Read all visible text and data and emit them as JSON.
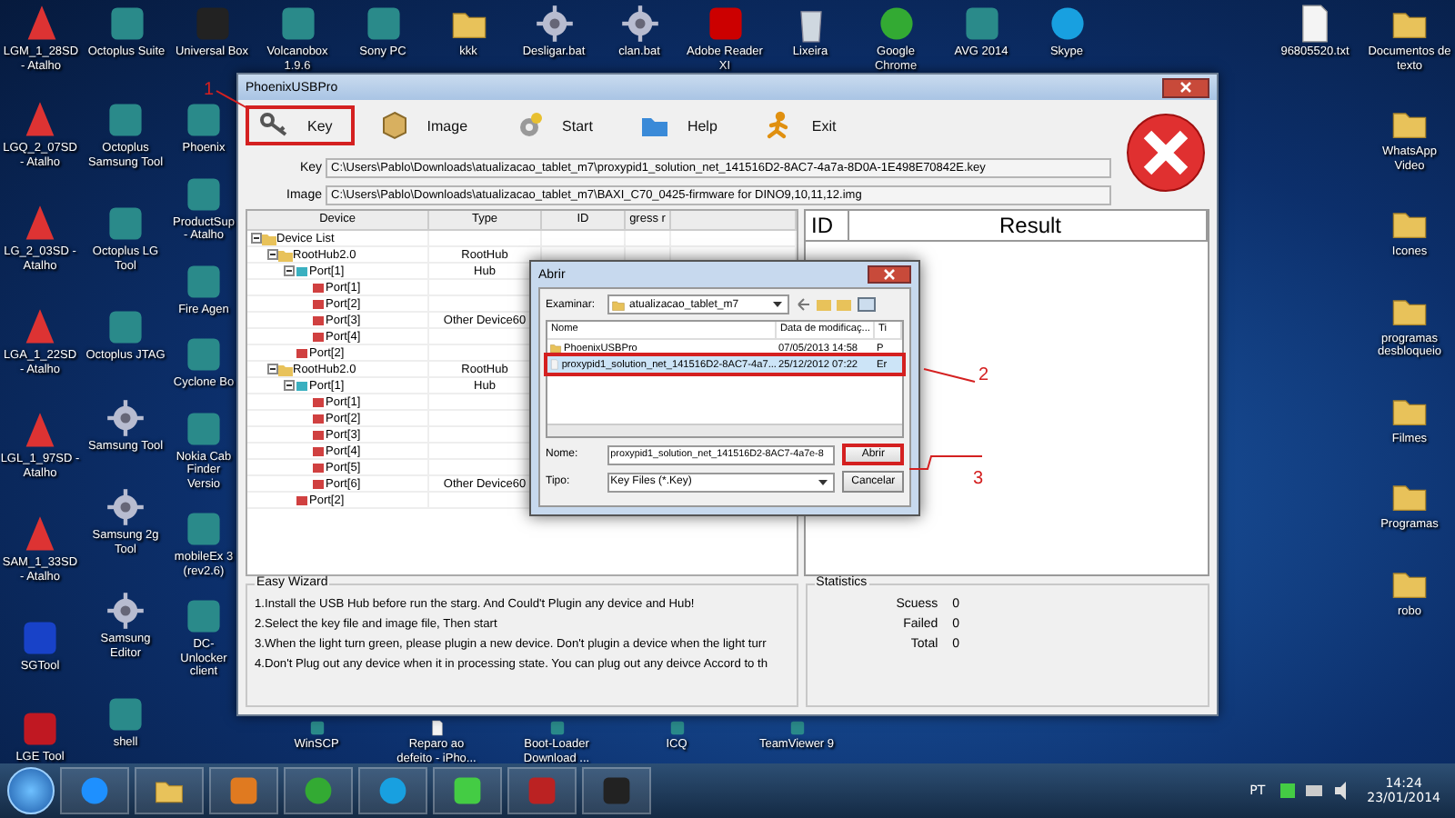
{
  "desktop": {
    "top_row": [
      {
        "label": "LGM_1_28SD - Atalho",
        "kind": "lg"
      },
      {
        "label": "Octoplus Suite",
        "kind": "app"
      },
      {
        "label": "Universal Box",
        "kind": "chip"
      },
      {
        "label": "Volcanobox 1.9.6",
        "kind": "app"
      },
      {
        "label": "Sony PC",
        "kind": "app"
      },
      {
        "label": "kkk",
        "kind": "folder"
      },
      {
        "label": "Desligar.bat",
        "kind": "gear"
      },
      {
        "label": "clan.bat",
        "kind": "gear"
      },
      {
        "label": "Adobe Reader XI",
        "kind": "pdf"
      },
      {
        "label": "Lixeira",
        "kind": "trash"
      },
      {
        "label": "Google Chrome",
        "kind": "chrome"
      },
      {
        "label": "AVG 2014",
        "kind": "app"
      },
      {
        "label": "Skype",
        "kind": "skype"
      }
    ],
    "left_column": [
      {
        "label": "LGQ_2_07SD - Atalho",
        "kind": "lg"
      },
      {
        "label": "LG_2_03SD - Atalho",
        "kind": "lg"
      },
      {
        "label": "LGA_1_22SD - Atalho",
        "kind": "lg"
      },
      {
        "label": "LGL_1_97SD - Atalho",
        "kind": "lg"
      },
      {
        "label": "SAM_1_33SD - Atalho",
        "kind": "lg"
      },
      {
        "label": "SGTool",
        "kind": "sgt"
      },
      {
        "label": "LGE Tool",
        "kind": "lgt"
      }
    ],
    "second_column": [
      {
        "label": "Octoplus Samsung Tool",
        "kind": "app"
      },
      {
        "label": "Octoplus LG Tool",
        "kind": "app"
      },
      {
        "label": "Octoplus JTAG",
        "kind": "app"
      },
      {
        "label": "Samsung Tool",
        "kind": "gear"
      },
      {
        "label": "Samsung 2g Tool",
        "kind": "gear"
      },
      {
        "label": "Samsung Editor",
        "kind": "gear"
      },
      {
        "label": "shell",
        "kind": "app"
      }
    ],
    "third_column": [
      {
        "label": "Phoenix",
        "kind": "app"
      },
      {
        "label": "ProductSup - Atalho",
        "kind": "app"
      },
      {
        "label": "Fire Agen",
        "kind": "app"
      },
      {
        "label": "Cyclone Bo",
        "kind": "app"
      },
      {
        "label": "Nokia Cab Finder Versio",
        "kind": "app"
      },
      {
        "label": "mobileEx 3 (rev2.6)",
        "kind": "app"
      },
      {
        "label": "DC-Unlocker client",
        "kind": "app"
      }
    ],
    "right_column": [
      {
        "label": "Documentos de texto",
        "kind": "folder"
      },
      {
        "label": "WhatsApp Video",
        "kind": "folder"
      },
      {
        "label": "Icones",
        "kind": "folder"
      },
      {
        "label": "programas desbloqueio",
        "kind": "folder"
      },
      {
        "label": "Filmes",
        "kind": "folder"
      },
      {
        "label": "Programas",
        "kind": "folder"
      },
      {
        "label": "robo",
        "kind": "folder"
      }
    ],
    "top_file": {
      "label": "96805520.txt",
      "kind": "file"
    },
    "bottom_row": [
      {
        "label": "WinSCP",
        "kind": "app"
      },
      {
        "label": "Reparo ao defeito - iPho...",
        "kind": "file"
      },
      {
        "label": "Boot-Loader Download ...",
        "kind": "app"
      },
      {
        "label": "ICQ",
        "kind": "app"
      },
      {
        "label": "TeamViewer 9",
        "kind": "app"
      }
    ]
  },
  "window": {
    "title": "PhoenixUSBPro",
    "toolbar": [
      {
        "label": "Key",
        "kind": "key",
        "highlighted": true
      },
      {
        "label": "Image",
        "kind": "image",
        "highlighted": false
      },
      {
        "label": "Start",
        "kind": "start",
        "highlighted": false
      },
      {
        "label": "Help",
        "kind": "help",
        "highlighted": false
      },
      {
        "label": "Exit",
        "kind": "exit",
        "highlighted": false
      }
    ],
    "fields": [
      {
        "label": "Key",
        "value": "C:\\Users\\Pablo\\Downloads\\atualizacao_tablet_m7\\proxypid1_solution_net_141516D2-8AC7-4a7a-8D0A-1E498E70842E.key"
      },
      {
        "label": "Image",
        "value": "C:\\Users\\Pablo\\Downloads\\atualizacao_tablet_m7\\BAXI_C70_0425-firmware for DINO9,10,11,12.img"
      }
    ],
    "device_table": {
      "columns": [
        "Device",
        "Type",
        "ID",
        "gress r"
      ],
      "tree": [
        {
          "name": "Device List",
          "children": [
            {
              "name": "RootHub2.0",
              "type": "RootHub",
              "children": [
                {
                  "name": "Port[1]",
                  "type": "Hub",
                  "children": [
                    {
                      "name": "Port[1]"
                    },
                    {
                      "name": "Port[2]"
                    },
                    {
                      "name": "Port[3]",
                      "type": "Other Device60"
                    },
                    {
                      "name": "Port[4]"
                    }
                  ]
                },
                {
                  "name": "Port[2]"
                }
              ]
            },
            {
              "name": "RootHub2.0",
              "type": "RootHub",
              "children": [
                {
                  "name": "Port[1]",
                  "type": "Hub",
                  "children": [
                    {
                      "name": "Port[1]"
                    },
                    {
                      "name": "Port[2]"
                    },
                    {
                      "name": "Port[3]"
                    },
                    {
                      "name": "Port[4]"
                    },
                    {
                      "name": "Port[5]"
                    },
                    {
                      "name": "Port[6]",
                      "type": "Other Device60"
                    }
                  ]
                },
                {
                  "name": "Port[2]"
                }
              ]
            }
          ]
        }
      ]
    },
    "result_table": {
      "columns": [
        "ID",
        "Result"
      ]
    },
    "wizard": {
      "title": "Easy Wizard",
      "lines": [
        "1.Install the USB Hub before run the starg. And Could't Plugin any device and Hub!",
        "2.Select the key file and image file, Then start",
        "3.When the light turn green, please plugin a new device. Don't plugin a device when the light turr",
        "4.Don't Plug out any device when it in processing state. You can plug out any deivce Accord to th"
      ]
    },
    "statistics": {
      "title": "Statistics",
      "rows": [
        {
          "label": "Scuess",
          "value": "0"
        },
        {
          "label": "Failed",
          "value": "0"
        },
        {
          "label": "Total",
          "value": "0"
        }
      ]
    }
  },
  "dialog": {
    "title": "Abrir",
    "look_in_label": "Examinar:",
    "look_in": "atualizacao_tablet_m7",
    "columns": [
      "Nome",
      "Data de modificaç...",
      "Ti"
    ],
    "files": [
      {
        "name": "PhoenixUSBPro",
        "date": "07/05/2013 14:58",
        "type": "P",
        "kind": "folder",
        "selected": false,
        "highlighted": false
      },
      {
        "name": "proxypid1_solution_net_141516D2-8AC7-4a7...",
        "date": "25/12/2012 07:22",
        "type": "Er",
        "kind": "file",
        "selected": true,
        "highlighted": true
      }
    ],
    "name_label": "Nome:",
    "name_value": "proxypid1_solution_net_141516D2-8AC7-4a7e-8",
    "type_label": "Tipo:",
    "type_value": "Key Files (*.Key)",
    "open_button": {
      "label": "Abrir",
      "highlighted": true
    },
    "cancel_button": "Cancelar"
  },
  "annotations": [
    "1",
    "2",
    "3"
  ],
  "taskbar": {
    "apps": [
      {
        "kind": "ie"
      },
      {
        "kind": "explorer"
      },
      {
        "kind": "media"
      },
      {
        "kind": "chrome"
      },
      {
        "kind": "skype"
      },
      {
        "kind": "icq"
      },
      {
        "kind": "tool"
      },
      {
        "kind": "chip"
      }
    ],
    "language": "PT",
    "time": "14:24",
    "date": "23/01/2014"
  }
}
